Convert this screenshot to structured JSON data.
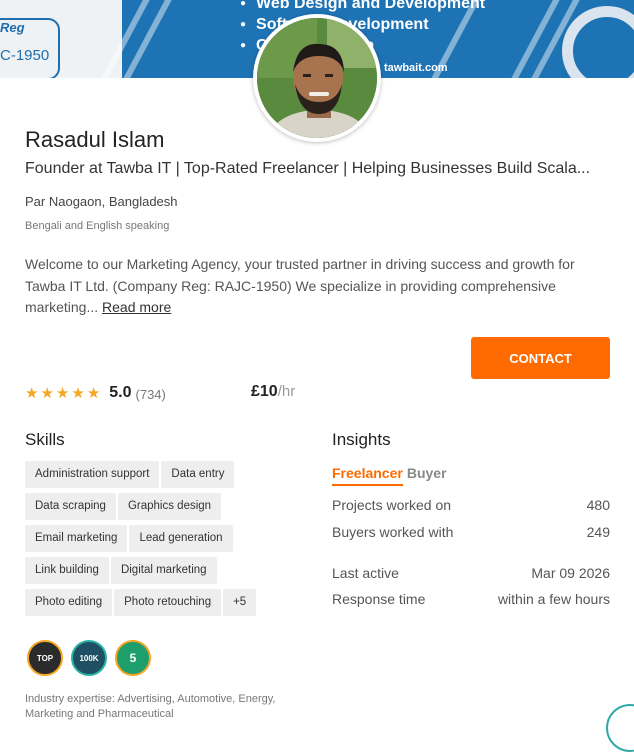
{
  "banner": {
    "reg_label": "Reg",
    "reg_number": "C-1950",
    "services": [
      "Web Design and Development",
      "Software Development",
      "Content Design"
    ],
    "url": "tawbait.com"
  },
  "profile": {
    "name": "Rasadul Islam",
    "headline": "Founder at Tawba IT | Top-Rated Freelancer | Helping Businesses Build Scala...",
    "location": "Par Naogaon, Bangladesh",
    "languages": "Bengali and English speaking",
    "about": "Welcome to our Marketing Agency, your trusted partner in driving success and growth for Tawba IT Ltd. (Company Reg: RAJC-1950) We specialize in providing comprehensive marketing...",
    "read_more": "Read more",
    "contact_label": "CONTACT"
  },
  "rating": {
    "stars": 5,
    "score": "5.0",
    "reviews": "(734)",
    "rate": "£10",
    "rate_unit": "/hr"
  },
  "skills": {
    "title": "Skills",
    "items": [
      "Administration support",
      "Data entry",
      "Data scraping",
      "Graphics design",
      "Email marketing",
      "Lead generation",
      "Link building",
      "Digital marketing",
      "Photo editing",
      "Photo retouching",
      "+5"
    ]
  },
  "insights": {
    "title": "Insights",
    "tab_active": "Freelancer",
    "tab_inactive": "Buyer",
    "rows": [
      {
        "label": "Projects worked on",
        "value": "480"
      },
      {
        "label": "Buyers worked with",
        "value": "249"
      },
      {
        "label": "Last active",
        "value": "Mar 09 2026"
      },
      {
        "label": "Response time",
        "value": "within a few hours"
      }
    ]
  },
  "badges": {
    "top": "TOP",
    "earnings": "100K",
    "years": "5"
  },
  "expertise": "Industry expertise: Advertising, Automotive, Energy, Marketing and Pharmaceutical",
  "colors": {
    "accent": "#ff6b00",
    "banner_blue": "#1e73b4",
    "star": "#f5a623"
  }
}
